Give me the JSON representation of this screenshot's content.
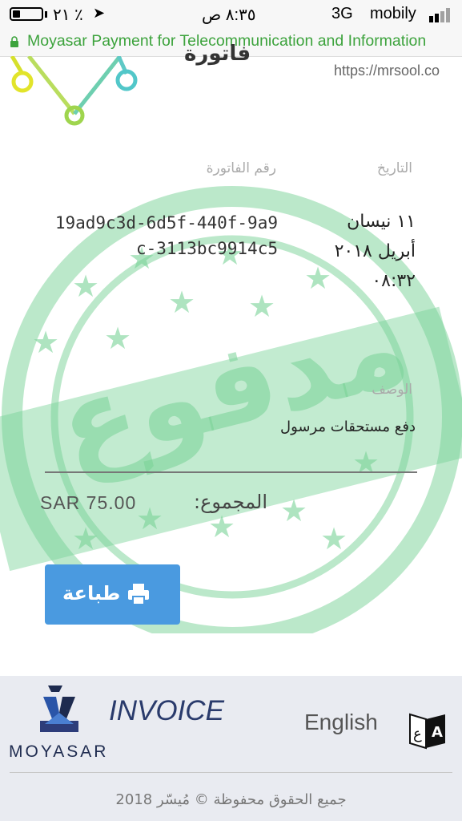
{
  "status_bar": {
    "battery_percent": "٢١ ٪",
    "battery_level": 0.25,
    "time": "٨:٣٥ ص",
    "network": "3G",
    "carrier": "mobily"
  },
  "browser": {
    "url_text": "Moyasar Payment for Telecommunication and Information"
  },
  "invoice": {
    "title": "فاتورة",
    "site_url": "https://mrsool.co",
    "date_label": "التاريخ",
    "invoice_number_label": "رقم الفاتورة",
    "date_value": "١١ نيسان أبريل ٢٠١٨ ٠٨:٣٢",
    "invoice_number_value": "19ad9c3d-6d5f-440f-9a9c-3113bc9914c5",
    "description_label": "الوصف",
    "description_value": "دفع مستحقات مرسول",
    "total_label": "المجموع:",
    "total_amount": "SAR 75.00",
    "print_button": "طباعة",
    "stamp_text": "مدفوع"
  },
  "footer": {
    "brand": "MOYASAR",
    "invoice_word": "INVOICE",
    "language_toggle": "English",
    "copyright": "جميع الحقوق محفوظة © مُيسّر 2018"
  },
  "colors": {
    "url_green": "#3da33d",
    "button_blue": "#4a9ae0",
    "stamp_green": "#78d296",
    "footer_bg": "#e9ebf1"
  }
}
